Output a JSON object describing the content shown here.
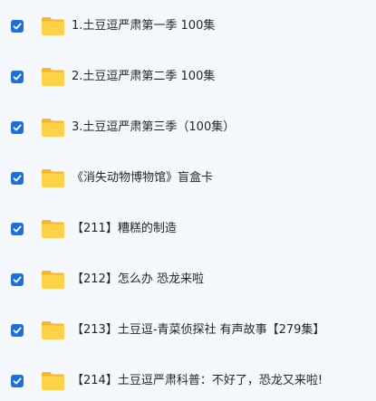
{
  "files": [
    {
      "name": "1.土豆逗严肃第一季 100集",
      "checked": true,
      "icon": "folder-icon"
    },
    {
      "name": "2.土豆逗严肃第二季 100集",
      "checked": true,
      "icon": "folder-icon"
    },
    {
      "name": "3.土豆逗严肃第三季（100集）",
      "checked": true,
      "icon": "folder-icon"
    },
    {
      "name": "《消失动物博物馆》盲盒卡",
      "checked": true,
      "icon": "folder-icon"
    },
    {
      "name": "【211】糟糕的制造",
      "checked": true,
      "icon": "folder-icon"
    },
    {
      "name": "【212】怎么办 恐龙来啦",
      "checked": true,
      "icon": "folder-icon"
    },
    {
      "name": "【213】土豆逗-青菜侦探社 有声故事【279集】",
      "checked": true,
      "icon": "folder-icon"
    },
    {
      "name": "【214】土豆逗严肃科普：不好了，恐龙又来啦!",
      "checked": true,
      "icon": "folder-icon"
    }
  ],
  "colors": {
    "background": "#f5f9fe",
    "checkbox": "#1f6fd6",
    "folder": "#ffd24a",
    "folder_back": "#f5b82e"
  }
}
